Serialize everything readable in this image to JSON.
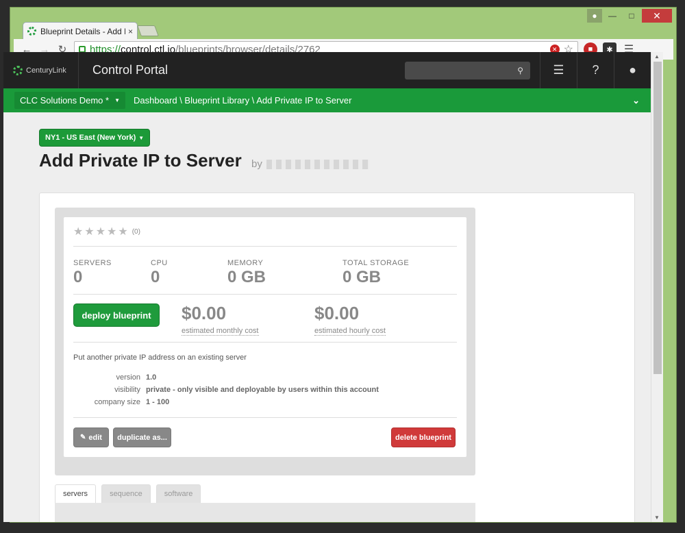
{
  "browser": {
    "tab_title": "Blueprint Details - Add Pr",
    "tab_close": "×",
    "url_scheme": "https://",
    "url_host": "control.ctl.io",
    "url_path": "/blueprints/browser/details/2762",
    "window_controls": {
      "minimize": "—",
      "maximize": "□",
      "close": "✕"
    }
  },
  "portal": {
    "logo_text": "CenturyLink",
    "title": "Control Portal"
  },
  "breadcrumb": {
    "account": "CLC Solutions Demo *",
    "path": "Dashboard \\ Blueprint Library \\ Add Private IP to Server"
  },
  "page": {
    "region": "NY1 - US East (New York)",
    "title": "Add Private IP to Server",
    "by": "by"
  },
  "blueprint": {
    "rating_count": "(0)",
    "stats": [
      {
        "label": "SERVERS",
        "value": "0"
      },
      {
        "label": "CPU",
        "value": "0"
      },
      {
        "label": "MEMORY",
        "value": "0 GB"
      },
      {
        "label": "TOTAL STORAGE",
        "value": "0 GB"
      }
    ],
    "deploy_label": "deploy blueprint",
    "monthly_cost": "$0.00",
    "monthly_label": "estimated monthly cost",
    "hourly_cost": "$0.00",
    "hourly_label": "estimated hourly cost",
    "description": "Put another private IP address on an existing server",
    "meta": [
      {
        "key": "version",
        "value": "1.0"
      },
      {
        "key": "visibility",
        "value": "private - only visible and deployable by users within this account"
      },
      {
        "key": "company size",
        "value": "1 - 100"
      }
    ],
    "edit_label": "edit",
    "duplicate_label": "duplicate as...",
    "delete_label": "delete blueprint"
  },
  "tabs": [
    "servers",
    "sequence",
    "software"
  ],
  "colors": {
    "brand_green": "#1a9a3a",
    "header_dark": "#222222",
    "delete_red": "#d03a3a"
  }
}
